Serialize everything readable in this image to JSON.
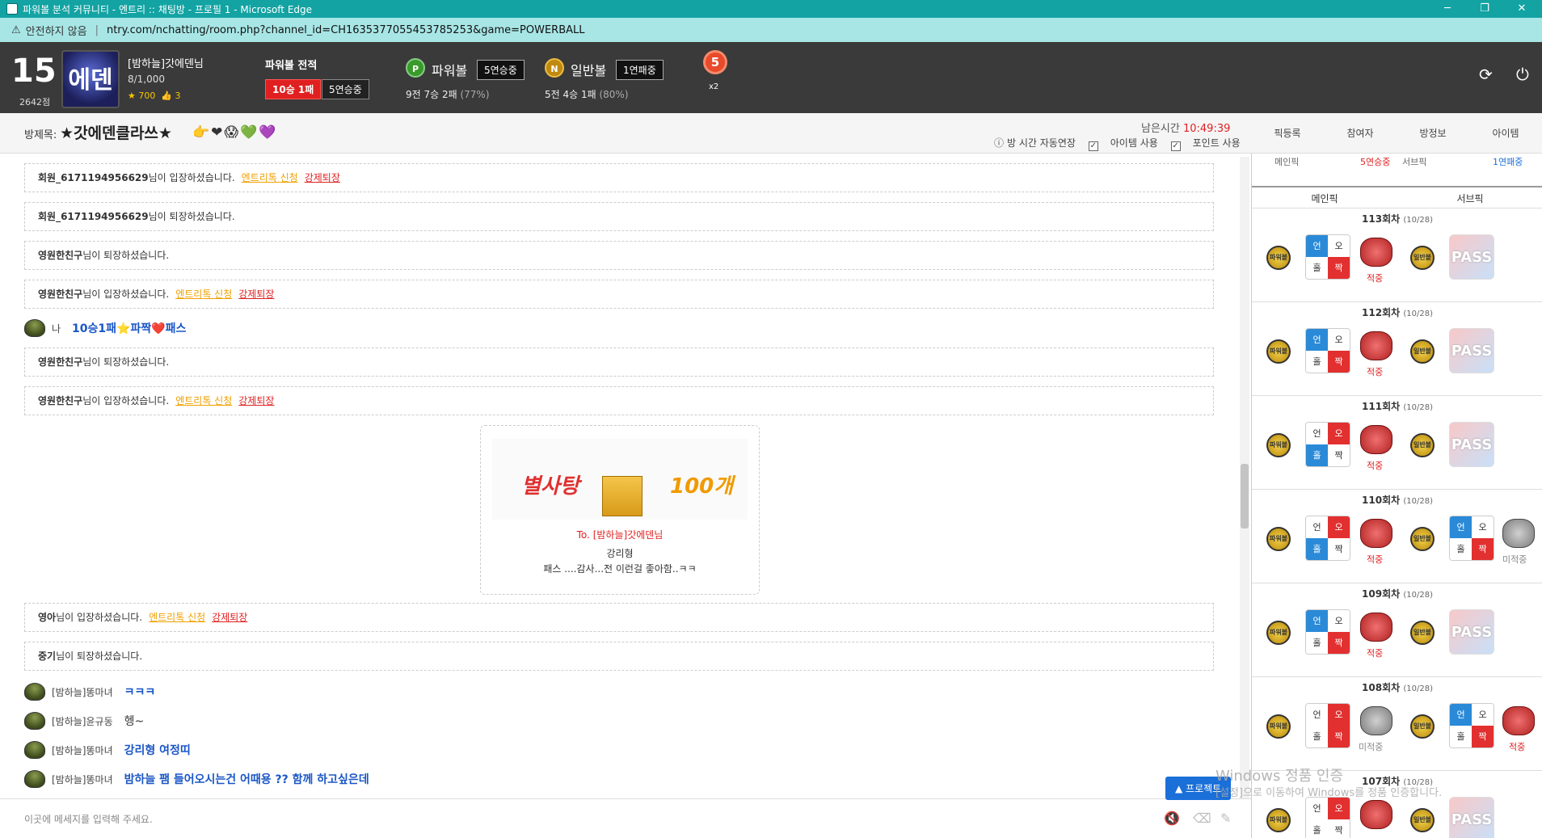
{
  "window": {
    "title": "파워볼 분석 커뮤니티 - 엔트리 :: 채팅방 - 프로필 1 - Microsoft Edge"
  },
  "address": {
    "warning": "안전하지 않음",
    "url": "ntry.com/nchatting/room.php?channel_id=CH1635377055453785253&game=POWERBALL"
  },
  "profile": {
    "level": "15",
    "points": "2642점",
    "avatar_text": "에덴",
    "name": "[밤하늘]갓에덴님",
    "count": "8/1,000",
    "stars": "★ 700",
    "likes": "👍 3"
  },
  "powerball_record": {
    "title": "파워볼 전적",
    "win": "10승 1패",
    "streak": "5연승중"
  },
  "pb": {
    "icon": "P",
    "label": "파워볼",
    "streak": "5연승중",
    "record": "9전 7승 2패",
    "pct": "(77%)"
  },
  "nb": {
    "icon": "N",
    "label": "일반볼",
    "streak": "1연패중",
    "record": "5전 4승 1패",
    "pct": "(80%)"
  },
  "medal": {
    "num": "5",
    "mult": "x2"
  },
  "room": {
    "label": "방제목:",
    "name": "★갓에덴클라쓰★",
    "emoji": "👉❤😱💚💜",
    "remain_label": "남은시간",
    "remain": "10:49:39",
    "auto": "방 시간 자동연장",
    "item": "아이템 사용",
    "point": "포인트 사용"
  },
  "tabs": [
    "픽등록",
    "참여자",
    "방정보",
    "아이템"
  ],
  "chat": {
    "sys": [
      {
        "user": "회원_6171194956629",
        "text": "님이 입장하셨습니다.",
        "req": "엔트리톡 신청",
        "kick": "강제퇴장"
      },
      {
        "user": "회원_6171194956629",
        "text": "님이 퇴장하셨습니다.",
        "req": "",
        "kick": ""
      },
      {
        "user": "영원한친구",
        "text": "님이 퇴장하셨습니다.",
        "req": "",
        "kick": ""
      },
      {
        "user": "영원한친구",
        "text": "님이 입장하셨습니다.",
        "req": "엔트리톡 신청",
        "kick": "강제퇴장"
      },
      {
        "user": "영원한친구",
        "text": "님이 퇴장하셨습니다.",
        "req": "",
        "kick": ""
      },
      {
        "user": "영원한친구",
        "text": "님이 입장하셨습니다.",
        "req": "엔트리톡 신청",
        "kick": "강제퇴장"
      },
      {
        "user": "영아",
        "text": "님이 입장하셨습니다.",
        "req": "엔트리톡 신청",
        "kick": "강제퇴장"
      },
      {
        "user": "중기",
        "text": "님이 퇴장하셨습니다.",
        "req": "",
        "kick": ""
      }
    ],
    "me": {
      "label": "나",
      "msg": "10승1패⭐파짝❤️패스"
    },
    "gift": {
      "candy": "별사탕",
      "count": "100개",
      "to": "To.",
      "to_user": "[밤하늘]갓에덴님",
      "from": "강리형",
      "note": "패스 ....감사...전 이런걸 좋아함..ㅋㅋ"
    },
    "users": [
      {
        "name": "[밤하늘]똥마녀",
        "msg": "ㅋㅋㅋ"
      },
      {
        "name": "[밤하늘]윤규동",
        "msg": "헹~"
      },
      {
        "name": "[밤하늘]똥마녀",
        "msg": "강리형 여정띠"
      },
      {
        "name": "[밤하늘]똥마녀",
        "msg": "밤하늘 팸 들어오시는건 어때용 ?? 함께 하고싶은데"
      }
    ]
  },
  "input": {
    "placeholder": "이곳에 메세지를 입력해 주세요."
  },
  "proj": "▲ 프로젝트",
  "side": {
    "top": {
      "main": "메인픽",
      "main_streak": "5연승중",
      "sub": "서브픽",
      "sub_streak": "1연패중"
    },
    "hdr": [
      "메인픽",
      "서브픽"
    ],
    "ball_main": "파워볼",
    "ball_sub": "일반볼",
    "cells": [
      "언",
      "오",
      "홀",
      "짝"
    ],
    "rounds": [
      {
        "title": "113회차",
        "date": "(10/28)",
        "r1": "적중",
        "r2": "",
        "pass": "PASS"
      },
      {
        "title": "112회차",
        "date": "(10/28)",
        "r1": "적중",
        "r2": "",
        "pass": "PASS"
      },
      {
        "title": "111회차",
        "date": "(10/28)",
        "r1": "적중",
        "r2": "",
        "pass": "PASS"
      },
      {
        "title": "110회차",
        "date": "(10/28)",
        "r1": "적중",
        "r2": "미적중",
        "pass": ""
      },
      {
        "title": "109회차",
        "date": "(10/28)",
        "r1": "적중",
        "r2": "",
        "pass": "PASS"
      },
      {
        "title": "108회차",
        "date": "(10/28)",
        "r1": "미적중",
        "r2": "적중",
        "pass": ""
      },
      {
        "title": "107회차",
        "date": "(10/28)",
        "r1": "",
        "r2": "",
        "pass": "PASS"
      }
    ]
  },
  "watermark": {
    "l1": "Windows 정품 인증",
    "l2": "[설정]으로 이동하여 Windows를 정품 인증합니다."
  }
}
